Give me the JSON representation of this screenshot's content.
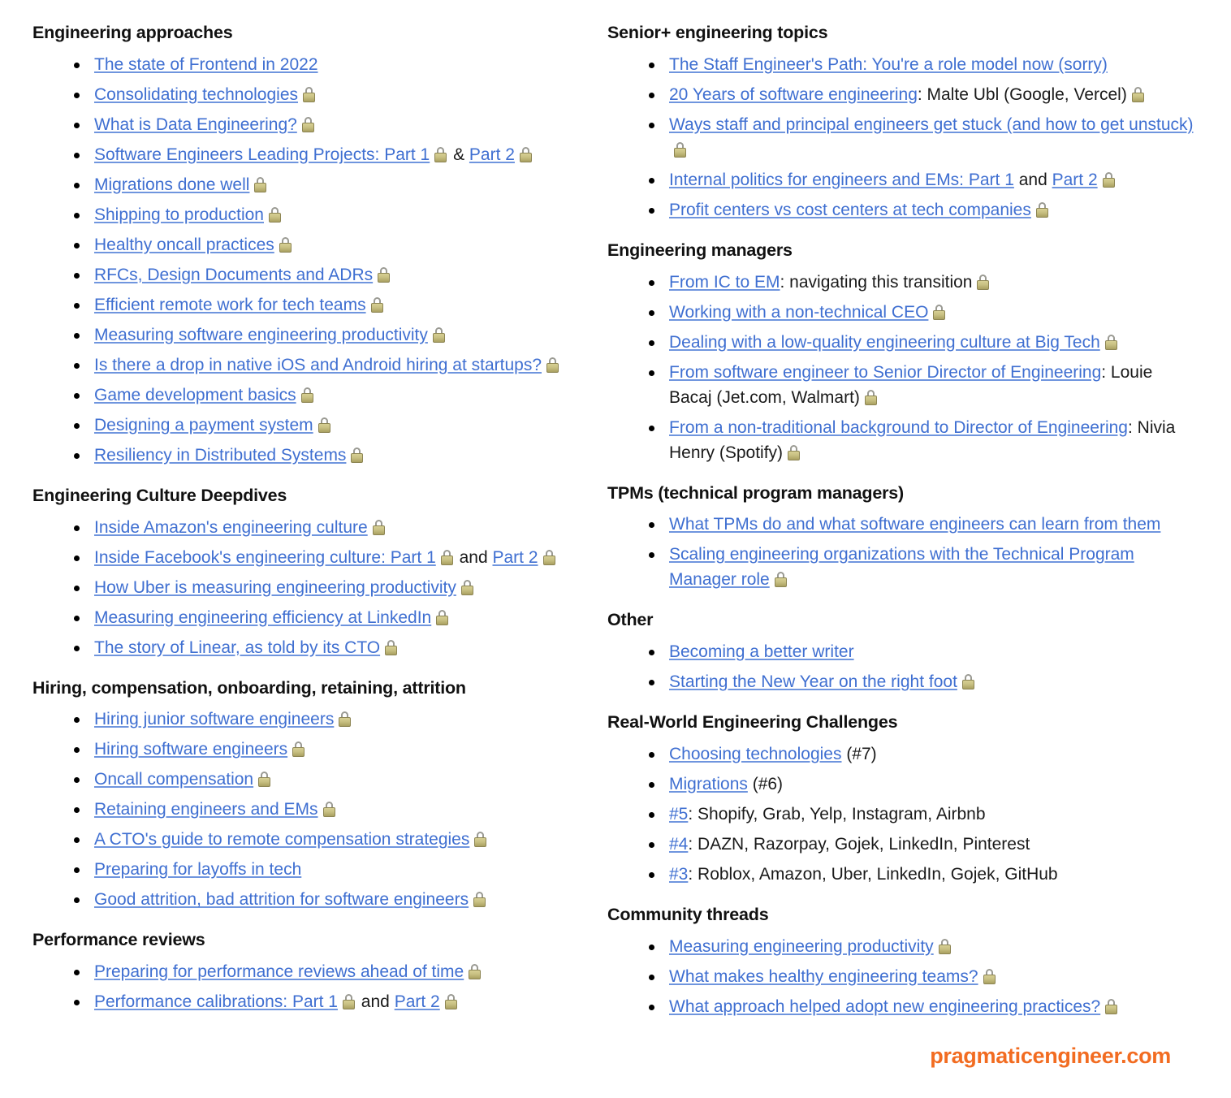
{
  "theme": {
    "link_color": "#3f6fd1",
    "text_color": "#1a1a1a",
    "heading_color": "#111111",
    "brand_color": "#f26c21",
    "background": "#ffffff",
    "lock_icon": "lock-icon"
  },
  "footer": {
    "brand": "pragmaticengineer.com"
  },
  "left_column": {
    "sections": [
      {
        "title": "Engineering approaches",
        "items": [
          {
            "parts": [
              {
                "type": "link",
                "text": "The state of Frontend in 2022"
              }
            ],
            "locked": false
          },
          {
            "parts": [
              {
                "type": "link",
                "text": "Consolidating technologies"
              }
            ],
            "locked": true
          },
          {
            "parts": [
              {
                "type": "link",
                "text": "What is Data Engineering?"
              }
            ],
            "locked": true
          },
          {
            "parts": [
              {
                "type": "link",
                "text": "Software Engineers Leading Projects: Part 1"
              },
              {
                "type": "lock"
              },
              {
                "type": "text",
                "text": " & "
              },
              {
                "type": "link",
                "text": "Part 2"
              },
              {
                "type": "lock"
              }
            ],
            "locked": false
          },
          {
            "parts": [
              {
                "type": "link",
                "text": "Migrations done well"
              }
            ],
            "locked": true
          },
          {
            "parts": [
              {
                "type": "link",
                "text": "Shipping to production"
              }
            ],
            "locked": true
          },
          {
            "parts": [
              {
                "type": "link",
                "text": "Healthy oncall practices"
              }
            ],
            "locked": true
          },
          {
            "parts": [
              {
                "type": "link",
                "text": "RFCs, Design Documents and ADRs"
              }
            ],
            "locked": true
          },
          {
            "parts": [
              {
                "type": "link",
                "text": "Efficient remote work for tech teams"
              }
            ],
            "locked": true
          },
          {
            "parts": [
              {
                "type": "link",
                "text": "Measuring software engineering productivity"
              }
            ],
            "locked": true
          },
          {
            "parts": [
              {
                "type": "link",
                "text": "Is there a drop in native iOS and Android hiring at startups?"
              }
            ],
            "locked": true
          },
          {
            "parts": [
              {
                "type": "link",
                "text": "Game development basics"
              }
            ],
            "locked": true
          },
          {
            "parts": [
              {
                "type": "link",
                "text": "Designing a payment system"
              }
            ],
            "locked": true
          },
          {
            "parts": [
              {
                "type": "link",
                "text": "Resiliency in Distributed Systems"
              }
            ],
            "locked": true
          }
        ]
      },
      {
        "title": "Engineering Culture Deepdives",
        "items": [
          {
            "parts": [
              {
                "type": "link",
                "text": "Inside Amazon's engineering culture"
              }
            ],
            "locked": true
          },
          {
            "parts": [
              {
                "type": "link",
                "text": "Inside Facebook's engineering culture: Part 1"
              },
              {
                "type": "lock"
              },
              {
                "type": "text",
                "text": "  and "
              },
              {
                "type": "link",
                "text": "Part 2"
              },
              {
                "type": "lock"
              }
            ],
            "locked": false
          },
          {
            "parts": [
              {
                "type": "link",
                "text": "How Uber is measuring engineering productivity"
              }
            ],
            "locked": true
          },
          {
            "parts": [
              {
                "type": "link",
                "text": "Measuring engineering efficiency at LinkedIn"
              }
            ],
            "locked": true
          },
          {
            "parts": [
              {
                "type": "link",
                "text": "The story of Linear, as told by its CTO"
              }
            ],
            "locked": true
          }
        ]
      },
      {
        "title": "Hiring, compensation, onboarding, retaining, attrition",
        "items": [
          {
            "parts": [
              {
                "type": "link",
                "text": "Hiring junior software engineers"
              }
            ],
            "locked": true
          },
          {
            "parts": [
              {
                "type": "link",
                "text": "Hiring software engineers"
              }
            ],
            "locked": true
          },
          {
            "parts": [
              {
                "type": "link",
                "text": "Oncall compensation"
              }
            ],
            "locked": true
          },
          {
            "parts": [
              {
                "type": "link",
                "text": "Retaining engineers and EMs"
              }
            ],
            "locked": true
          },
          {
            "parts": [
              {
                "type": "link",
                "text": "A CTO's guide to remote compensation strategies"
              }
            ],
            "locked": true
          },
          {
            "parts": [
              {
                "type": "link",
                "text": "Preparing for layoffs in tech"
              }
            ],
            "locked": false
          },
          {
            "parts": [
              {
                "type": "link",
                "text": "Good attrition, bad attrition for software engineers"
              }
            ],
            "locked": true
          }
        ]
      },
      {
        "title": "Performance reviews",
        "items": [
          {
            "parts": [
              {
                "type": "link",
                "text": "Preparing for performance reviews ahead of time"
              }
            ],
            "locked": true
          },
          {
            "parts": [
              {
                "type": "link",
                "text": "Performance calibrations: Part 1"
              },
              {
                "type": "lock"
              },
              {
                "type": "text",
                "text": " and "
              },
              {
                "type": "link",
                "text": "Part 2"
              },
              {
                "type": "lock"
              }
            ],
            "locked": false
          }
        ]
      }
    ]
  },
  "right_column": {
    "sections": [
      {
        "title": "Senior+ engineering topics",
        "items": [
          {
            "parts": [
              {
                "type": "link",
                "text": "The Staff Engineer's Path: You're a role model now (sorry)"
              }
            ],
            "locked": false
          },
          {
            "parts": [
              {
                "type": "link",
                "text": "20 Years of software engineering"
              },
              {
                "type": "text",
                "text": ": Malte Ubl (Google, Vercel)"
              }
            ],
            "locked": true
          },
          {
            "parts": [
              {
                "type": "link",
                "text": "Ways staff and principal engineers get stuck (and how to get unstuck)"
              }
            ],
            "locked": true
          },
          {
            "parts": [
              {
                "type": "link",
                "text": "Internal politics for engineers and EMs: Part 1"
              },
              {
                "type": "text",
                "text": " and "
              },
              {
                "type": "link",
                "text": "Part 2"
              },
              {
                "type": "lock"
              }
            ],
            "locked": false
          },
          {
            "parts": [
              {
                "type": "link",
                "text": "Profit centers vs cost centers at tech companies"
              }
            ],
            "locked": true
          }
        ]
      },
      {
        "title": "Engineering managers",
        "items": [
          {
            "parts": [
              {
                "type": "link",
                "text": "From IC to EM"
              },
              {
                "type": "text",
                "text": ": navigating this transition"
              }
            ],
            "locked": true
          },
          {
            "parts": [
              {
                "type": "link",
                "text": "Working with a non-technical CEO"
              }
            ],
            "locked": true
          },
          {
            "parts": [
              {
                "type": "link",
                "text": "Dealing with a low-quality engineering culture at Big Tech"
              }
            ],
            "locked": true
          },
          {
            "parts": [
              {
                "type": "link",
                "text": "From software engineer to Senior Director of Engineering"
              },
              {
                "type": "text",
                "text": ": Louie Bacaj (Jet.com, Walmart)"
              }
            ],
            "locked": true
          },
          {
            "parts": [
              {
                "type": "link",
                "text": "From a non-traditional background to Director of Engineering"
              },
              {
                "type": "text",
                "text": ": Nivia Henry (Spotify)"
              }
            ],
            "locked": true
          }
        ]
      },
      {
        "title": "TPMs (technical program managers)",
        "items": [
          {
            "parts": [
              {
                "type": "link",
                "text": "What TPMs do and what software engineers can learn from them"
              }
            ],
            "locked": false
          },
          {
            "parts": [
              {
                "type": "link",
                "text": "Scaling engineering organizations with the Technical Program Manager role"
              }
            ],
            "locked": true
          }
        ]
      },
      {
        "title": "Other",
        "items": [
          {
            "parts": [
              {
                "type": "link",
                "text": "Becoming a better writer"
              }
            ],
            "locked": false
          },
          {
            "parts": [
              {
                "type": "link",
                "text": "Starting the New Year on the right foot"
              }
            ],
            "locked": true
          }
        ]
      },
      {
        "title": "Real-World Engineering Challenges",
        "items": [
          {
            "parts": [
              {
                "type": "link",
                "text": "Choosing technologies"
              },
              {
                "type": "text",
                "text": " (#7)"
              }
            ],
            "locked": false
          },
          {
            "parts": [
              {
                "type": "link",
                "text": "Migrations"
              },
              {
                "type": "text",
                "text": " (#6)"
              }
            ],
            "locked": false
          },
          {
            "parts": [
              {
                "type": "link",
                "text": "#5"
              },
              {
                "type": "text",
                "text": ": Shopify, Grab, Yelp, Instagram, Airbnb"
              }
            ],
            "locked": false
          },
          {
            "parts": [
              {
                "type": "link",
                "text": "#4"
              },
              {
                "type": "text",
                "text": ": DAZN, Razorpay, Gojek, LinkedIn, Pinterest"
              }
            ],
            "locked": false
          },
          {
            "parts": [
              {
                "type": "link",
                "text": "#3"
              },
              {
                "type": "text",
                "text": ": Roblox, Amazon, Uber, LinkedIn, Gojek, GitHub"
              }
            ],
            "locked": false
          }
        ]
      },
      {
        "title": "Community threads",
        "items": [
          {
            "parts": [
              {
                "type": "link",
                "text": "Measuring engineering productivity"
              }
            ],
            "locked": true
          },
          {
            "parts": [
              {
                "type": "link",
                "text": "What makes healthy engineering teams?"
              }
            ],
            "locked": true
          },
          {
            "parts": [
              {
                "type": "link",
                "text": "What approach helped adopt new engineering practices?"
              }
            ],
            "locked": true
          }
        ]
      }
    ]
  }
}
